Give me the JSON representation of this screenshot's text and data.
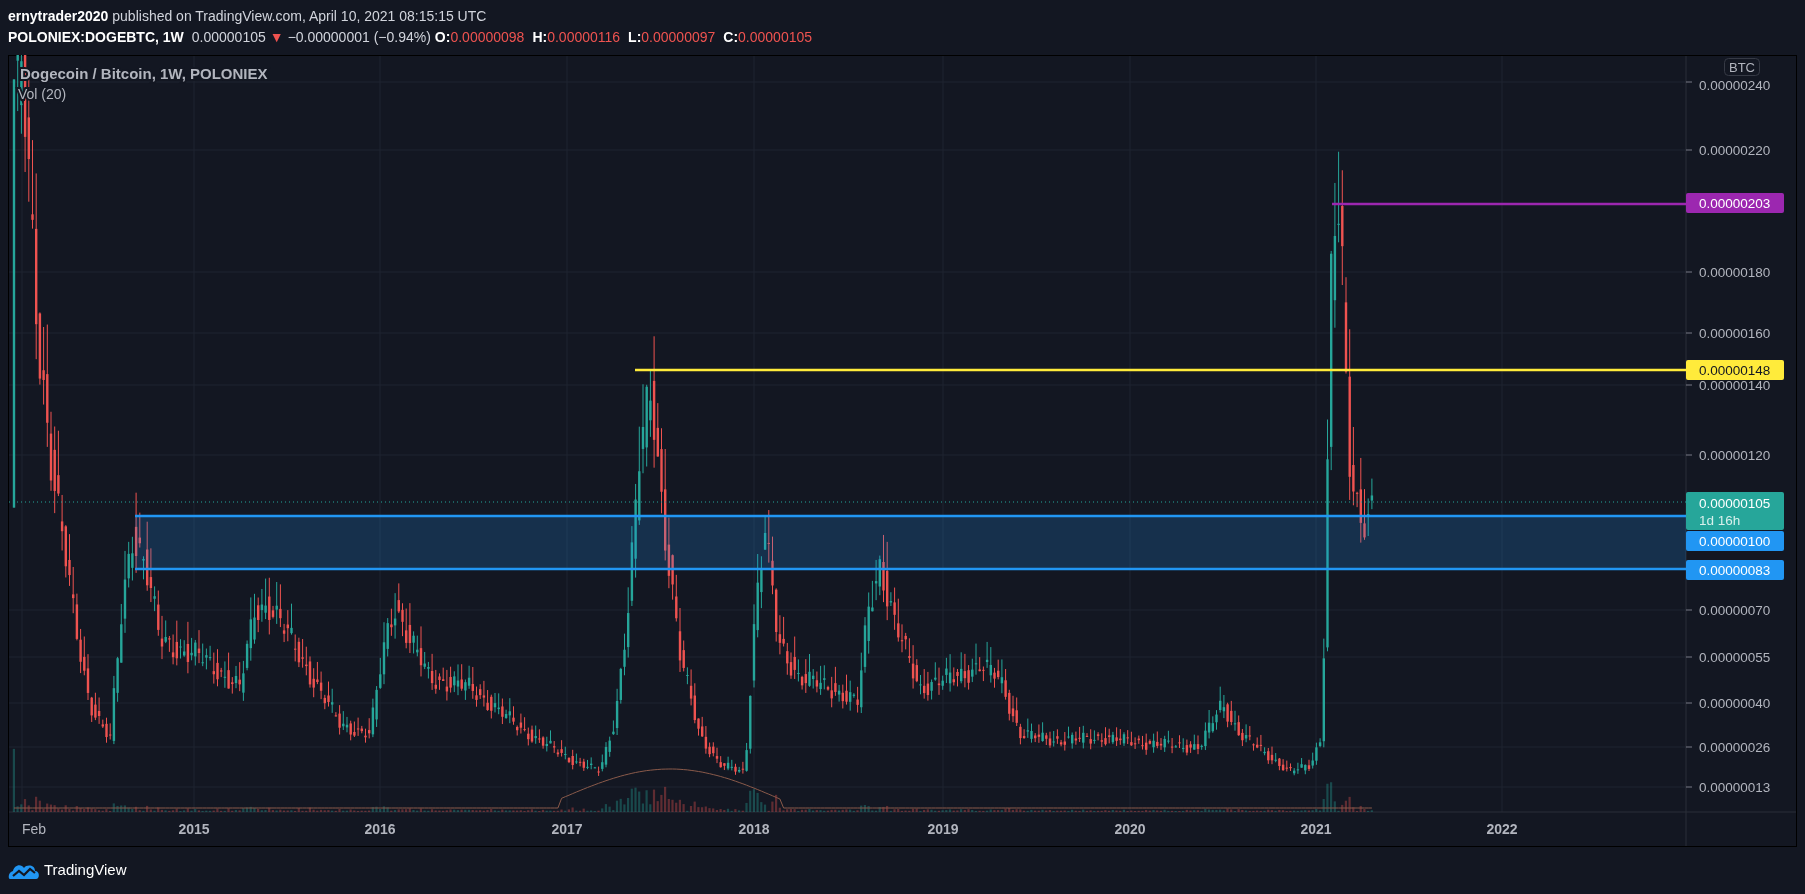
{
  "header": {
    "published": "**ernytrader2020** published on TradingView.com, April 10, 2021 08:15:15 UTC"
  },
  "symbol_bar": {
    "symbol": "POLONIEX:DOGEBTC, 1W",
    "price": "0.00000105",
    "arrow": "▼",
    "change": "−0.00000001 (−0.94%)",
    "ohlc": [
      "**O:**0.00000098",
      "**H:**0.00000116",
      "**L:**0.00000097",
      "**C:**0.00000105"
    ]
  },
  "chart": {
    "title": "Dogecoin / Bitcoin, 1W, POLONIEX",
    "indicator": "Vol (20)",
    "currency": "BTC",
    "y_ticks": [
      "0.00000240",
      "0.00000220",
      "0.00000180",
      "0.00000160",
      "0.00000140",
      "0.00000120",
      "0.00000070",
      "0.00000055",
      "0.00000040",
      "0.00000026",
      "0.00000013"
    ],
    "x_ticks": [
      {
        "label": "Feb",
        "kind": "month"
      },
      {
        "label": "2015",
        "kind": "year"
      },
      {
        "label": "2016",
        "kind": "year"
      },
      {
        "label": "2017",
        "kind": "year"
      },
      {
        "label": "2018",
        "kind": "year"
      },
      {
        "label": "2019",
        "kind": "year"
      },
      {
        "label": "2020",
        "kind": "year"
      },
      {
        "label": "2021",
        "kind": "year"
      },
      {
        "label": "2022",
        "kind": "year"
      }
    ],
    "price_lines": [
      {
        "label": "0.00000203",
        "color": "#9c27b0"
      },
      {
        "label": "0.00000148",
        "color": "#ffeb3b"
      },
      {
        "label": "0.00000100",
        "color": "#2196f3"
      },
      {
        "label": "0.00000083",
        "color": "#2196f3"
      }
    ],
    "current_price": {
      "label": "0.00000105",
      "countdown": "1d 16h",
      "color": "#26a69a"
    }
  },
  "footer": {
    "logo": "TradingView"
  }
}
